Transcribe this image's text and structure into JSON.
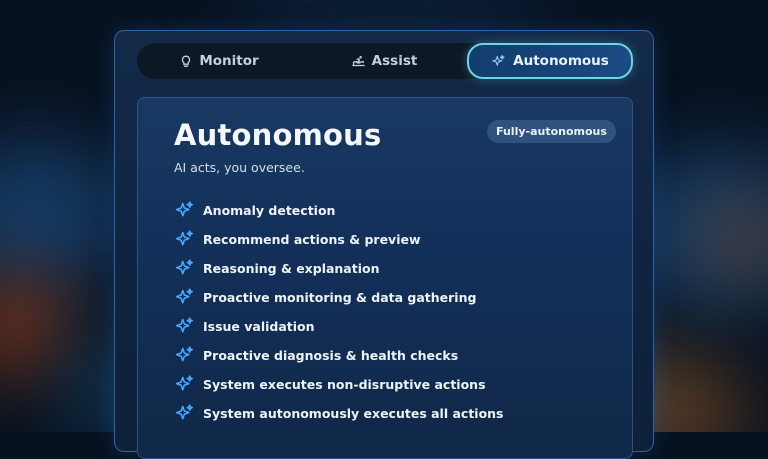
{
  "tabs": [
    {
      "label": "Monitor",
      "icon": "lightbulb-icon"
    },
    {
      "label": "Assist",
      "icon": "hand-icon"
    },
    {
      "label": "Autonomous",
      "icon": "sparkle-icon",
      "active": true
    }
  ],
  "card": {
    "title": "Autonomous",
    "subtitle": "AI acts, you oversee.",
    "badge": "Fully-autonomous"
  },
  "features": [
    {
      "label": "Anomaly detection"
    },
    {
      "label": "Recommend actions & preview"
    },
    {
      "label": "Reasoning & explanation"
    },
    {
      "label": "Proactive monitoring & data gathering"
    },
    {
      "label": "Issue validation"
    },
    {
      "label": "Proactive diagnosis & health checks"
    },
    {
      "label": "System executes non-disruptive actions"
    },
    {
      "label": "System autonomously executes all actions"
    }
  ],
  "colors": {
    "accent": "#4aa8ff",
    "active_tab_border": "#6fd3e4",
    "panel_border": "#2c64a6",
    "background": "#07111f"
  }
}
